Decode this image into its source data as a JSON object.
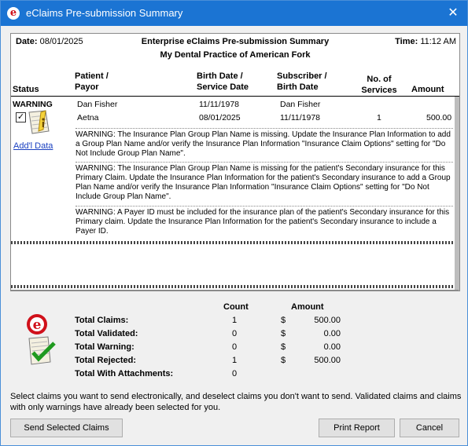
{
  "window": {
    "title": "eClaims Pre-submission Summary"
  },
  "report": {
    "date_label": "Date:",
    "date_value": "08/01/2025",
    "time_label": "Time:",
    "time_value": "11:12 AM",
    "title": "Enterprise eClaims Pre-submission Summary",
    "practice": "My Dental Practice of American Fork",
    "columns": {
      "status": "Status",
      "patient_line1": "Patient /",
      "patient_line2": "Payor",
      "birth_line1": "Birth Date /",
      "birth_line2": "Service Date",
      "subscriber_line1": "Subscriber /",
      "subscriber_line2": "Birth Date",
      "services_line1": "No. of",
      "services_line2": "Services",
      "amount": "Amount"
    },
    "claim": {
      "status": "WARNING",
      "checked": "✓",
      "patient": "Dan Fisher",
      "payor": "Aetna",
      "birth_date": "11/11/1978",
      "service_date": "08/01/2025",
      "subscriber": "Dan Fisher",
      "subscriber_birth": "11/11/1978",
      "services": "1",
      "amount": "500.00",
      "addl_data": "Add'l Data",
      "warnings": [
        "WARNING: The Insurance Plan Group Plan Name is missing. Update the Insurance Plan Information to add a Group Plan Name and/or verify the Insurance Plan Information \"Insurance Claim Options\" setting for \"Do Not Include Group Plan Name\".",
        "WARNING: The Insurance Plan Group Plan Name is missing for the patient's Secondary insurance for this Primary Claim. Update the Insurance Plan Information for the patient's Secondary insurance to add a Group Plan Name and/or verify the Insurance Plan Information \"Insurance Claim Options\" setting for \"Do Not Include Group Plan Name\".",
        "WARNING: A Payer ID must be included for the insurance plan of the patient's Secondary insurance for this Primary claim. Update the Insurance Plan Information for the patient's Secondary insurance to include a Payer ID."
      ]
    }
  },
  "summary": {
    "count_header": "Count",
    "amount_header": "Amount",
    "rows": [
      {
        "label": "Total Claims:",
        "count": "1",
        "dollar": "$",
        "amount": "500.00"
      },
      {
        "label": "Total Validated:",
        "count": "0",
        "dollar": "$",
        "amount": "0.00"
      },
      {
        "label": "Total Warning:",
        "count": "0",
        "dollar": "$",
        "amount": "0.00"
      },
      {
        "label": "Total Rejected:",
        "count": "1",
        "dollar": "$",
        "amount": "500.00"
      },
      {
        "label": "Total With Attachments:",
        "count": "0"
      }
    ]
  },
  "footer": {
    "instructions": "Select claims you want to send electronically, and deselect claims you don't want to send.  Validated claims and claims with only warnings have already been selected for you.",
    "send_button": "Send Selected Claims",
    "print_button": "Print Report",
    "cancel_button": "Cancel"
  }
}
